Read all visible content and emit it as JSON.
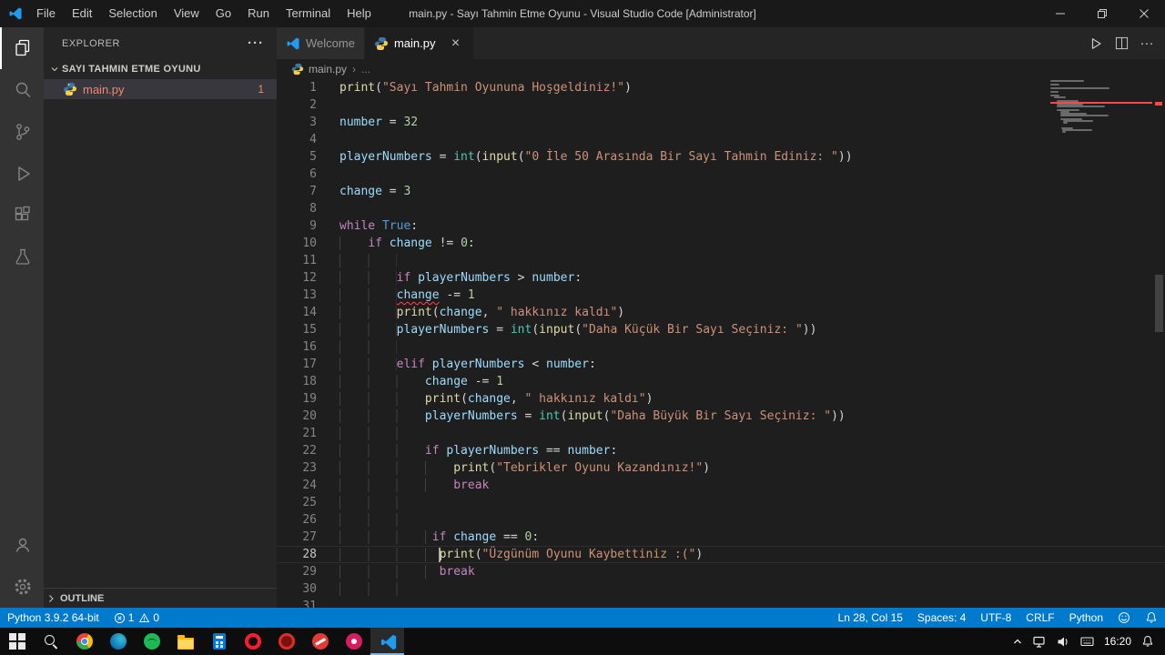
{
  "window": {
    "title": "main.py - Sayı Tahmin Etme Oyunu - Visual Studio Code [Administrator]",
    "menus": [
      "File",
      "Edit",
      "Selection",
      "View",
      "Go",
      "Run",
      "Terminal",
      "Help"
    ]
  },
  "activity_bar": {
    "items": [
      "explorer",
      "search",
      "source-control",
      "run-debug",
      "extensions",
      "testing"
    ],
    "bottom_items": [
      "account",
      "settings"
    ],
    "active": "explorer"
  },
  "sidebar": {
    "title": "EXPLORER",
    "actions_label": "···",
    "section": "SAYI TAHMIN ETME OYUNU",
    "files": [
      {
        "name": "main.py",
        "problems": "1"
      }
    ],
    "outline_label": "OUTLINE"
  },
  "tabs": [
    {
      "label": "Welcome",
      "icon": "vscode",
      "active": false
    },
    {
      "label": "main.py",
      "icon": "python",
      "active": true,
      "close_label": "×"
    }
  ],
  "editor_actions": {
    "more_label": "···"
  },
  "breadcrumb": {
    "file": "main.py",
    "separator": "›",
    "symbol": "..."
  },
  "editor": {
    "cursor_line": 28,
    "error_line": 13,
    "lines": [
      {
        "n": 1,
        "t": [
          [
            "print",
            "fn"
          ],
          [
            "(",
            "pl"
          ],
          [
            "\"Sayı Tahmin Oyununa Hoşgeldiniz!\"",
            "st"
          ],
          [
            ")",
            "pl"
          ]
        ]
      },
      {
        "n": 2,
        "t": []
      },
      {
        "n": 3,
        "t": [
          [
            "number",
            "vr"
          ],
          [
            " = ",
            "pl"
          ],
          [
            "32",
            "nu"
          ]
        ]
      },
      {
        "n": 4,
        "t": []
      },
      {
        "n": 5,
        "t": [
          [
            "playerNumbers",
            "vr"
          ],
          [
            " = ",
            "pl"
          ],
          [
            "int",
            "cl"
          ],
          [
            "(",
            "pl"
          ],
          [
            "input",
            "fn"
          ],
          [
            "(",
            "pl"
          ],
          [
            "\"0 İle 50 Arasında Bir Sayı Tahmin Ediniz: \"",
            "st"
          ],
          [
            "))",
            "pl"
          ]
        ]
      },
      {
        "n": 6,
        "t": []
      },
      {
        "n": 7,
        "t": [
          [
            "change",
            "vr"
          ],
          [
            " = ",
            "pl"
          ],
          [
            "3",
            "nu"
          ]
        ]
      },
      {
        "n": 8,
        "t": []
      },
      {
        "n": 9,
        "t": [
          [
            "while",
            "kw"
          ],
          [
            " ",
            "pl"
          ],
          [
            "True",
            "ct"
          ],
          [
            ":",
            "pl"
          ]
        ]
      },
      {
        "n": 10,
        "t": [
          [
            "    ",
            "ind"
          ],
          [
            "if",
            "kw"
          ],
          [
            " ",
            "pl"
          ],
          [
            "change",
            "vr"
          ],
          [
            " != ",
            "pl"
          ],
          [
            "0",
            "nu"
          ],
          [
            ":",
            "pl"
          ]
        ]
      },
      {
        "n": 11,
        "t": [
          [
            "        ",
            "ind"
          ]
        ]
      },
      {
        "n": 12,
        "t": [
          [
            "        ",
            "ind"
          ],
          [
            "if",
            "kw"
          ],
          [
            " ",
            "pl"
          ],
          [
            "playerNumbers",
            "vr"
          ],
          [
            " > ",
            "pl"
          ],
          [
            "number",
            "vr"
          ],
          [
            ":",
            "pl"
          ]
        ]
      },
      {
        "n": 13,
        "t": [
          [
            "        ",
            "ind"
          ],
          [
            "change",
            "vr sq"
          ],
          [
            " -= ",
            "pl"
          ],
          [
            "1",
            "nu"
          ]
        ]
      },
      {
        "n": 14,
        "t": [
          [
            "        ",
            "ind"
          ],
          [
            "print",
            "fn"
          ],
          [
            "(",
            "pl"
          ],
          [
            "change",
            "vr"
          ],
          [
            ", ",
            "pl"
          ],
          [
            "\" hakkınız kaldı\"",
            "st"
          ],
          [
            ")",
            "pl"
          ]
        ]
      },
      {
        "n": 15,
        "t": [
          [
            "        ",
            "ind"
          ],
          [
            "playerNumbers",
            "vr"
          ],
          [
            " = ",
            "pl"
          ],
          [
            "int",
            "cl"
          ],
          [
            "(",
            "pl"
          ],
          [
            "input",
            "fn"
          ],
          [
            "(",
            "pl"
          ],
          [
            "\"Daha Küçük Bir Sayı Seçiniz: \"",
            "st"
          ],
          [
            "))",
            "pl"
          ]
        ]
      },
      {
        "n": 16,
        "t": [
          [
            "        ",
            "ind"
          ]
        ]
      },
      {
        "n": 17,
        "t": [
          [
            "        ",
            "ind"
          ],
          [
            "elif",
            "kw"
          ],
          [
            " ",
            "pl"
          ],
          [
            "playerNumbers",
            "vr"
          ],
          [
            " < ",
            "pl"
          ],
          [
            "number",
            "vr"
          ],
          [
            ":",
            "pl"
          ]
        ]
      },
      {
        "n": 18,
        "t": [
          [
            "            ",
            "ind"
          ],
          [
            "change",
            "vr"
          ],
          [
            " -= ",
            "pl"
          ],
          [
            "1",
            "nu"
          ]
        ]
      },
      {
        "n": 19,
        "t": [
          [
            "            ",
            "ind"
          ],
          [
            "print",
            "fn"
          ],
          [
            "(",
            "pl"
          ],
          [
            "change",
            "vr"
          ],
          [
            ", ",
            "pl"
          ],
          [
            "\" hakkınız kaldı\"",
            "st"
          ],
          [
            ")",
            "pl"
          ]
        ]
      },
      {
        "n": 20,
        "t": [
          [
            "            ",
            "ind"
          ],
          [
            "playerNumbers",
            "vr"
          ],
          [
            " = ",
            "pl"
          ],
          [
            "int",
            "cl"
          ],
          [
            "(",
            "pl"
          ],
          [
            "input",
            "fn"
          ],
          [
            "(",
            "pl"
          ],
          [
            "\"Daha Büyük Bir Sayı Seçiniz: \"",
            "st"
          ],
          [
            "))",
            "pl"
          ]
        ]
      },
      {
        "n": 21,
        "t": [
          [
            "            ",
            "ind"
          ]
        ]
      },
      {
        "n": 22,
        "t": [
          [
            "            ",
            "ind"
          ],
          [
            "if",
            "kw"
          ],
          [
            " ",
            "pl"
          ],
          [
            "playerNumbers",
            "vr"
          ],
          [
            " == ",
            "pl"
          ],
          [
            "number",
            "vr"
          ],
          [
            ":",
            "pl"
          ]
        ]
      },
      {
        "n": 23,
        "t": [
          [
            "                ",
            "ind"
          ],
          [
            "print",
            "fn"
          ],
          [
            "(",
            "pl"
          ],
          [
            "\"Tebrikler Oyunu Kazandınız!\"",
            "st"
          ],
          [
            ")",
            "pl"
          ]
        ]
      },
      {
        "n": 24,
        "t": [
          [
            "                ",
            "ind"
          ],
          [
            "break",
            "kw"
          ]
        ]
      },
      {
        "n": 25,
        "t": [
          [
            "            ",
            "ind"
          ]
        ]
      },
      {
        "n": 26,
        "t": [
          [
            "            ",
            "ind"
          ]
        ]
      },
      {
        "n": 27,
        "t": [
          [
            "             ",
            "ind"
          ],
          [
            "if",
            "kw"
          ],
          [
            " ",
            "pl"
          ],
          [
            "change",
            "vr"
          ],
          [
            " == ",
            "pl"
          ],
          [
            "0",
            "nu"
          ],
          [
            ":",
            "pl"
          ]
        ]
      },
      {
        "n": 28,
        "t": [
          [
            "              ",
            "ind"
          ],
          [
            "",
            "cur"
          ],
          [
            "print",
            "fn"
          ],
          [
            "(",
            "pl"
          ],
          [
            "\"Üzgünüm Oyunu Kaybettiniz :(\"",
            "st"
          ],
          [
            ")",
            "pl"
          ]
        ]
      },
      {
        "n": 29,
        "t": [
          [
            "              ",
            "ind"
          ],
          [
            "break",
            "kw"
          ]
        ]
      },
      {
        "n": 30,
        "t": [
          [
            "            ",
            "ind"
          ]
        ]
      },
      {
        "n": 31,
        "t": []
      }
    ]
  },
  "status_bar": {
    "python_version": "Python 3.9.2 64-bit",
    "errors": "1",
    "warnings": "0",
    "line_col": "Ln 28, Col 15",
    "spaces": "Spaces: 4",
    "encoding": "UTF-8",
    "eol": "CRLF",
    "language": "Python"
  },
  "taskbar": {
    "pinned": [
      "start",
      "search",
      "chrome",
      "edge",
      "spotify",
      "file-explorer",
      "calculator",
      "opera",
      "app-red",
      "app-crimson",
      "app-pink",
      "vscode"
    ],
    "active_app": "vscode",
    "tray_time": "16:20"
  },
  "colors": {
    "accent": "#007acc",
    "error": "#f14c4c",
    "file_error": "#f48771",
    "editor_bg": "#1e1e1e",
    "sidebar_bg": "#252526",
    "activity_bg": "#333333"
  }
}
